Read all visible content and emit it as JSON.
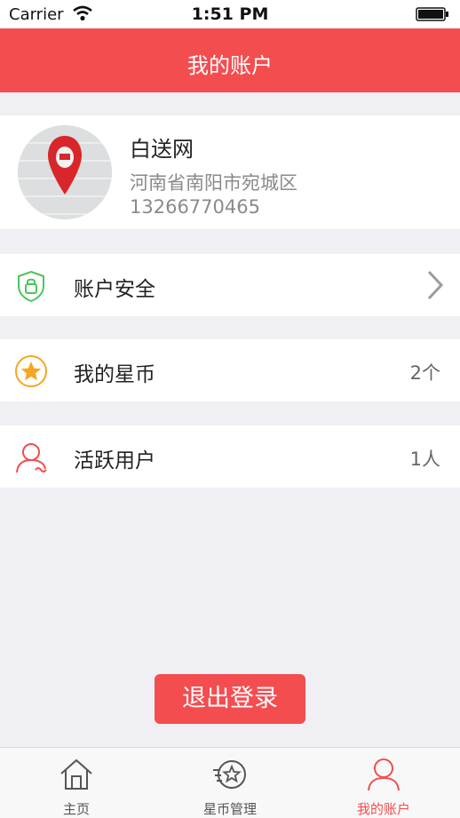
{
  "status_bar": {
    "carrier": "Carrier",
    "time": "1:51 PM"
  },
  "nav": {
    "title": "我的账户"
  },
  "profile": {
    "name": "白送网",
    "location": "河南省南阳市宛城区",
    "phone": "13266770465"
  },
  "menu": {
    "security": {
      "label": "账户安全",
      "icon": "shield-lock-icon"
    },
    "coins": {
      "label": "我的星币",
      "value": "2个",
      "icon": "star-icon"
    },
    "active_users": {
      "label": "活跃用户",
      "value": "1人",
      "icon": "user-icon"
    }
  },
  "actions": {
    "logout_label": "退出登录"
  },
  "tabs": [
    {
      "label": "主页",
      "icon": "home-icon",
      "active": false
    },
    {
      "label": "星币管理",
      "icon": "star-manage-icon",
      "active": false
    },
    {
      "label": "我的账户",
      "icon": "user-icon",
      "active": true
    }
  ],
  "colors": {
    "accent": "#f44d50",
    "security_green": "#4cc45c",
    "coin_orange": "#f5a623"
  }
}
